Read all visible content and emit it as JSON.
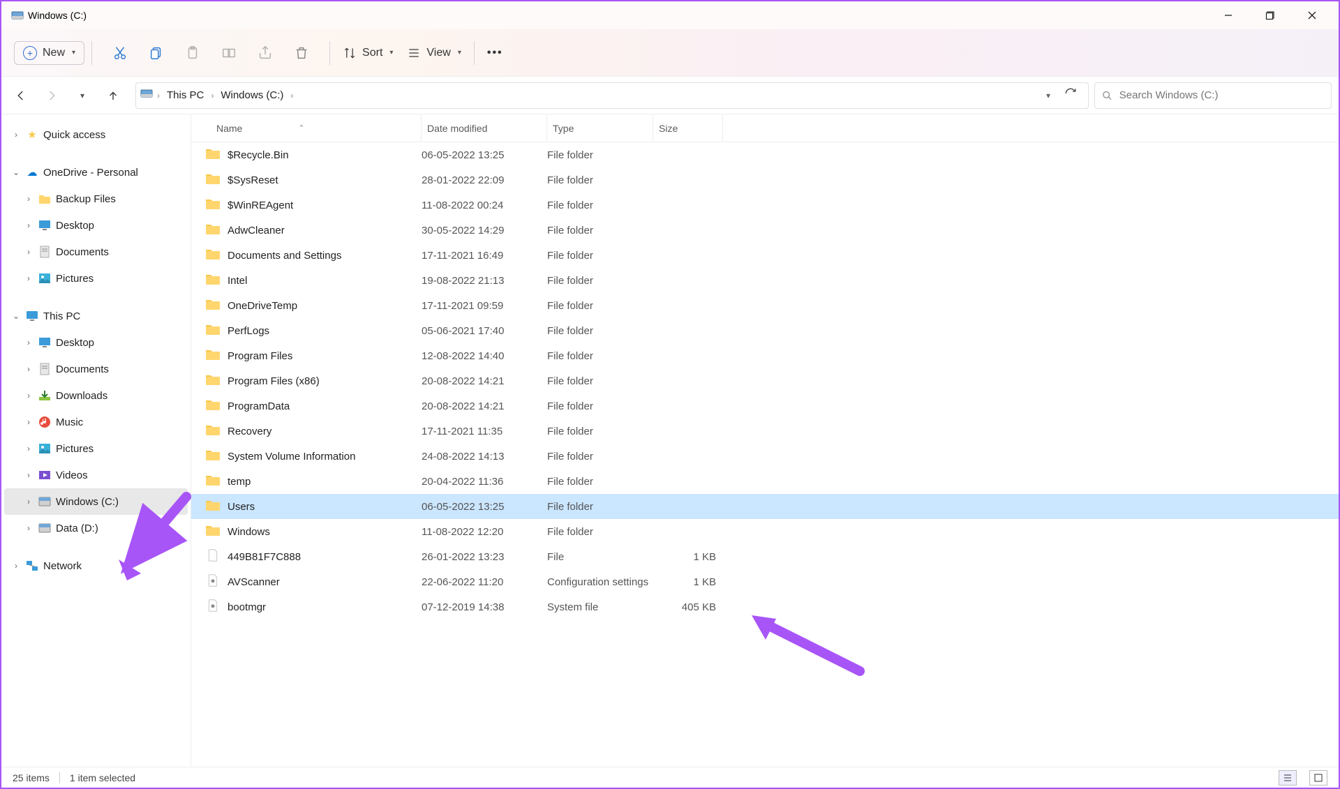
{
  "window": {
    "title": "Windows (C:)"
  },
  "toolbar": {
    "new_label": "New",
    "sort_label": "Sort",
    "view_label": "View"
  },
  "breadcrumb": {
    "items": [
      "This PC",
      "Windows (C:)"
    ]
  },
  "search": {
    "placeholder": "Search Windows (C:)"
  },
  "sidebar": {
    "quick_access": "Quick access",
    "onedrive": "OneDrive - Personal",
    "onedrive_children": [
      "Backup Files",
      "Desktop",
      "Documents",
      "Pictures"
    ],
    "this_pc": "This PC",
    "this_pc_children": [
      "Desktop",
      "Documents",
      "Downloads",
      "Music",
      "Pictures",
      "Videos",
      "Windows (C:)",
      "Data (D:)"
    ],
    "network": "Network"
  },
  "columns": {
    "name": "Name",
    "date": "Date modified",
    "type": "Type",
    "size": "Size"
  },
  "files": [
    {
      "name": "$Recycle.Bin",
      "date": "06-05-2022 13:25",
      "type": "File folder",
      "size": "",
      "icon": "folder"
    },
    {
      "name": "$SysReset",
      "date": "28-01-2022 22:09",
      "type": "File folder",
      "size": "",
      "icon": "folder"
    },
    {
      "name": "$WinREAgent",
      "date": "11-08-2022 00:24",
      "type": "File folder",
      "size": "",
      "icon": "folder"
    },
    {
      "name": "AdwCleaner",
      "date": "30-05-2022 14:29",
      "type": "File folder",
      "size": "",
      "icon": "folder"
    },
    {
      "name": "Documents and Settings",
      "date": "17-11-2021 16:49",
      "type": "File folder",
      "size": "",
      "icon": "folder-link"
    },
    {
      "name": "Intel",
      "date": "19-08-2022 21:13",
      "type": "File folder",
      "size": "",
      "icon": "folder"
    },
    {
      "name": "OneDriveTemp",
      "date": "17-11-2021 09:59",
      "type": "File folder",
      "size": "",
      "icon": "folder"
    },
    {
      "name": "PerfLogs",
      "date": "05-06-2021 17:40",
      "type": "File folder",
      "size": "",
      "icon": "folder"
    },
    {
      "name": "Program Files",
      "date": "12-08-2022 14:40",
      "type": "File folder",
      "size": "",
      "icon": "folder"
    },
    {
      "name": "Program Files (x86)",
      "date": "20-08-2022 14:21",
      "type": "File folder",
      "size": "",
      "icon": "folder"
    },
    {
      "name": "ProgramData",
      "date": "20-08-2022 14:21",
      "type": "File folder",
      "size": "",
      "icon": "folder"
    },
    {
      "name": "Recovery",
      "date": "17-11-2021 11:35",
      "type": "File folder",
      "size": "",
      "icon": "folder"
    },
    {
      "name": "System Volume Information",
      "date": "24-08-2022 14:13",
      "type": "File folder",
      "size": "",
      "icon": "folder"
    },
    {
      "name": "temp",
      "date": "20-04-2022 11:36",
      "type": "File folder",
      "size": "",
      "icon": "folder"
    },
    {
      "name": "Users",
      "date": "06-05-2022 13:25",
      "type": "File folder",
      "size": "",
      "icon": "folder",
      "selected": true
    },
    {
      "name": "Windows",
      "date": "11-08-2022 12:20",
      "type": "File folder",
      "size": "",
      "icon": "folder"
    },
    {
      "name": "449B81F7C888",
      "date": "26-01-2022 13:23",
      "type": "File",
      "size": "1 KB",
      "icon": "file"
    },
    {
      "name": "AVScanner",
      "date": "22-06-2022 11:20",
      "type": "Configuration settings",
      "size": "1 KB",
      "icon": "file-ini"
    },
    {
      "name": "bootmgr",
      "date": "07-12-2019 14:38",
      "type": "System file",
      "size": "405 KB",
      "icon": "file-sys"
    }
  ],
  "status": {
    "count": "25 items",
    "selection": "1 item selected"
  },
  "icons": {
    "star": "★",
    "cloud": "☁",
    "monitor": "🖥",
    "drive": "💽",
    "network": "🖧",
    "desktop": "🖥",
    "docs": "📄",
    "down": "⬇",
    "music": "🎵",
    "pics": "🖼",
    "videos": "🎞",
    "folder": "📁"
  }
}
